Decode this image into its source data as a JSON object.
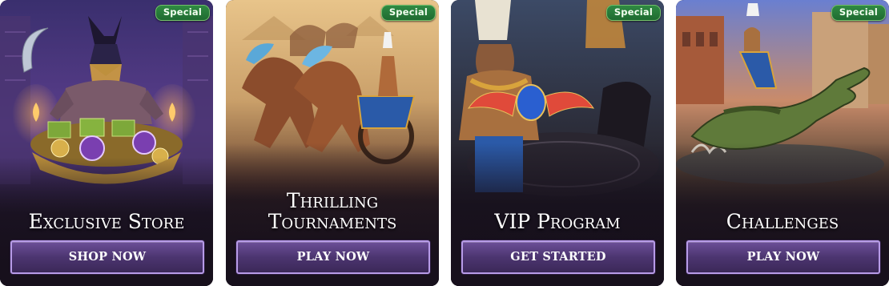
{
  "badge_label": "Special",
  "cards": [
    {
      "title": "Exclusive Store",
      "button": "SHOP NOW"
    },
    {
      "title_lines": [
        "Thrilling",
        "Tournaments"
      ],
      "button": "PLAY NOW"
    },
    {
      "title": "VIP Program",
      "button": "GET STARTED"
    },
    {
      "title": "Challenges",
      "button": "PLAY NOW"
    }
  ],
  "colors": {
    "badge": "#2f8a43",
    "button": "#4c3570",
    "button_border": "#b79be8",
    "card_bg": "#17101c"
  }
}
